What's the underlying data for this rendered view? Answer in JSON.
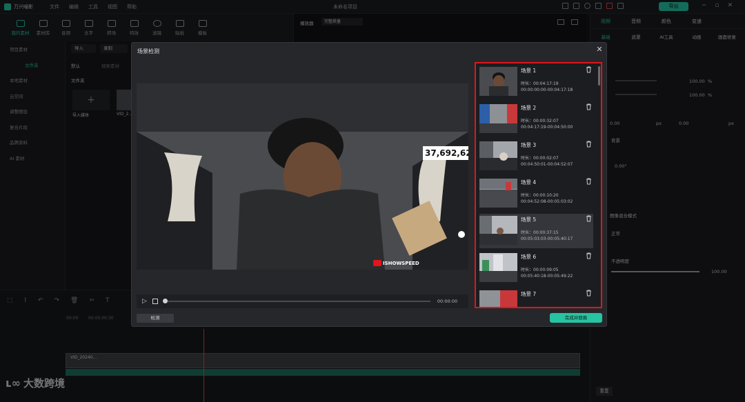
{
  "app": {
    "name": "万兴喵影",
    "project_title": "未命名项目",
    "export_label": "导出"
  },
  "menu": [
    "文件",
    "编辑",
    "工具",
    "视图",
    "帮助"
  ],
  "tools": [
    {
      "label": "我的素材",
      "active": true
    },
    {
      "label": "素材库"
    },
    {
      "label": "音频"
    },
    {
      "label": "文字"
    },
    {
      "label": "转场"
    },
    {
      "label": "特效"
    },
    {
      "label": "滤镜"
    },
    {
      "label": "贴纸"
    },
    {
      "label": "模板"
    }
  ],
  "left_nav": [
    "项目素材",
    "文件夹",
    "本地素材",
    "云空间",
    "调整图层",
    "复合片段",
    "品牌资料",
    "AI 素材"
  ],
  "media": {
    "import_label": "导入",
    "record_label": "录制",
    "sort_label": "默认",
    "search_placeholder": "搜索素材",
    "folder_label": "文件夹",
    "import_media_label": "导入媒体",
    "clip_name": "VID_2..."
  },
  "player": {
    "label": "播放器",
    "quality": "完整质量"
  },
  "right_tabs": [
    "视频",
    "音频",
    "颜色",
    "变速"
  ],
  "right_subtabs": [
    "基础",
    "遮罩",
    "AI工具",
    "动画",
    "画面修复"
  ],
  "right_values": {
    "scale": "100.00",
    "scale2": "100.00",
    "pos_x": "0.00",
    "pos_y": "0.00",
    "rotate": "0.00°",
    "opacity": "100.00",
    "percent": "%",
    "px": "px"
  },
  "right_labels": {
    "bg": "背景",
    "mix": "图像混合模式",
    "mode": "正常",
    "opacity_label": "不透明度",
    "reset": "重置"
  },
  "dialog": {
    "title": "场景检测",
    "time": "00:00:00",
    "detect_label": "检测",
    "finish_label": "完成并替换",
    "duration_prefix": "时长：",
    "scenes": [
      {
        "name": "场景 1",
        "duration": "00:04:17:19",
        "range": "00:00:00:00-00:04:17:18"
      },
      {
        "name": "场景 2",
        "duration": "00:00:32:07",
        "range": "00:04:17:19-00:04:50:00"
      },
      {
        "name": "场景 3",
        "duration": "00:00:02:07",
        "range": "00:04:50:01-00:04:52:07"
      },
      {
        "name": "场景 4",
        "duration": "00:00:10:20",
        "range": "00:04:52:08-00:05:03:02"
      },
      {
        "name": "场景 5",
        "duration": "00:00:37:15",
        "range": "00:05:03:03-00:05:40:17"
      },
      {
        "name": "场景 6",
        "duration": "00:00:09:05",
        "range": "00:05:40:18-00:05:49:22"
      },
      {
        "name": "场景 7",
        "duration": "",
        "range": ""
      }
    ],
    "video_overlay": {
      "counter": "37,692,62",
      "watermark": "ISHOWSPEED"
    }
  },
  "timeline": {
    "time_mark_1": "00:00",
    "time_mark_2": "00:00:00:30",
    "clip_label": "VID_20240...",
    "brand_watermark": "大数跨境"
  },
  "colors": {
    "accent": "#27c4a2",
    "highlight": "#e3151b"
  }
}
